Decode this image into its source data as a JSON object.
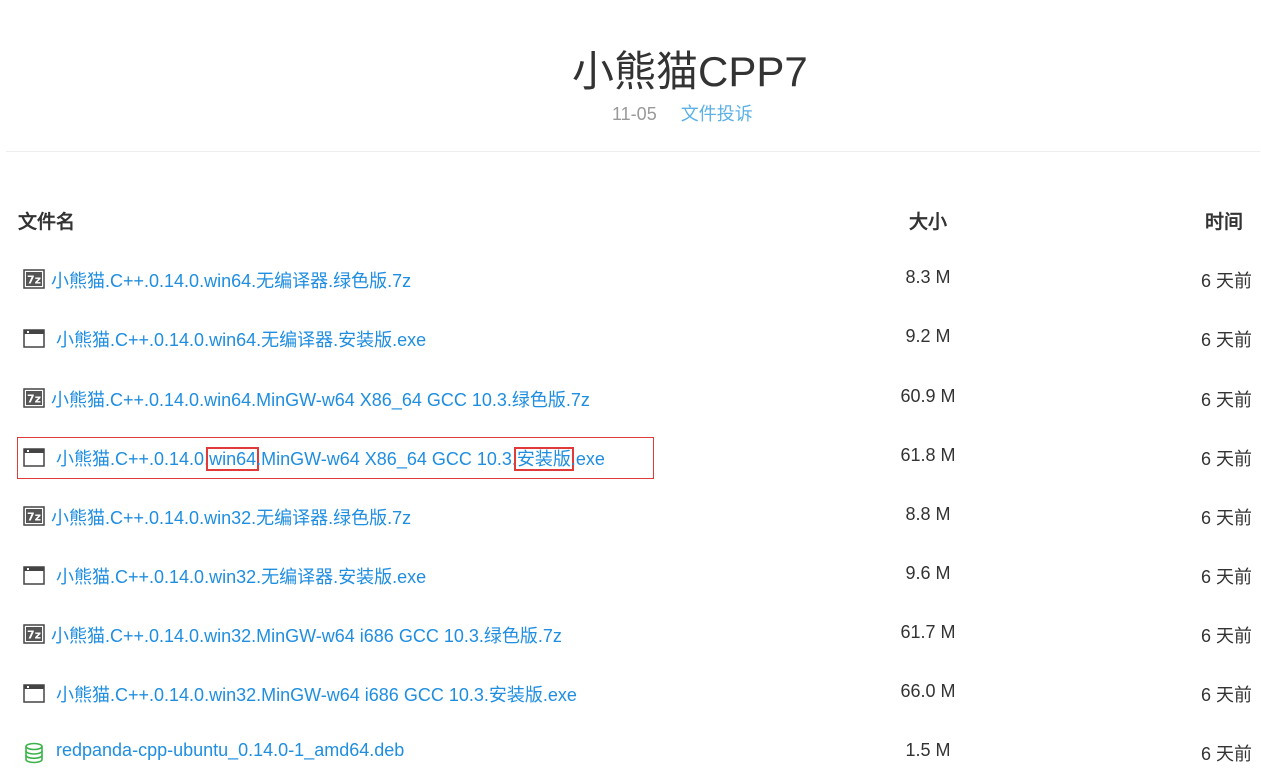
{
  "header": {
    "title": "小熊猫CPP7",
    "date": "11-05",
    "report_link": "文件投诉"
  },
  "table": {
    "columns": {
      "name": "文件名",
      "size": "大小",
      "time": "时间"
    },
    "rows": [
      {
        "icon": "archive-7z-icon",
        "name": "小熊猫.C++.0.14.0.win64.无编译器.绿色版.7z",
        "size": "8.3 M",
        "time": "6 天前"
      },
      {
        "icon": "exe-window-icon",
        "name": "小熊猫.C++.0.14.0.win64.无编译器.安装版.exe",
        "size": "9.2 M",
        "time": "6 天前"
      },
      {
        "icon": "archive-7z-icon",
        "name": "小熊猫.C++.0.14.0.win64.MinGW-w64 X86_64 GCC 10.3.绿色版.7z",
        "size": "60.9 M",
        "time": "6 天前"
      },
      {
        "icon": "exe-window-icon",
        "name_parts": [
          "小熊猫.C++.0.14.0.",
          "win64",
          ".MinGW-w64 X86_64 GCC 10.3.",
          "安装版",
          ".exe"
        ],
        "size": "61.8 M",
        "time": "6 天前"
      },
      {
        "icon": "archive-7z-icon",
        "name": "小熊猫.C++.0.14.0.win32.无编译器.绿色版.7z",
        "size": "8.8 M",
        "time": "6 天前"
      },
      {
        "icon": "exe-window-icon",
        "name": "小熊猫.C++.0.14.0.win32.无编译器.安装版.exe",
        "size": "9.6 M",
        "time": "6 天前"
      },
      {
        "icon": "archive-7z-icon",
        "name": "小熊猫.C++.0.14.0.win32.MinGW-w64 i686 GCC 10.3.绿色版.7z",
        "size": "61.7 M",
        "time": "6 天前"
      },
      {
        "icon": "exe-window-icon",
        "name": "小熊猫.C++.0.14.0.win32.MinGW-w64 i686 GCC 10.3.安装版.exe",
        "size": "66.0 M",
        "time": "6 天前"
      },
      {
        "icon": "database-deb-icon",
        "name": "redpanda-cpp-ubuntu_0.14.0-1_amd64.deb",
        "size": "1.5 M",
        "time": "6 天前"
      }
    ]
  },
  "colors": {
    "link": "#1f8ee0",
    "report_link": "#5bb1e6",
    "highlight": "#e03a3a",
    "deb_icon": "#3cb34a"
  }
}
